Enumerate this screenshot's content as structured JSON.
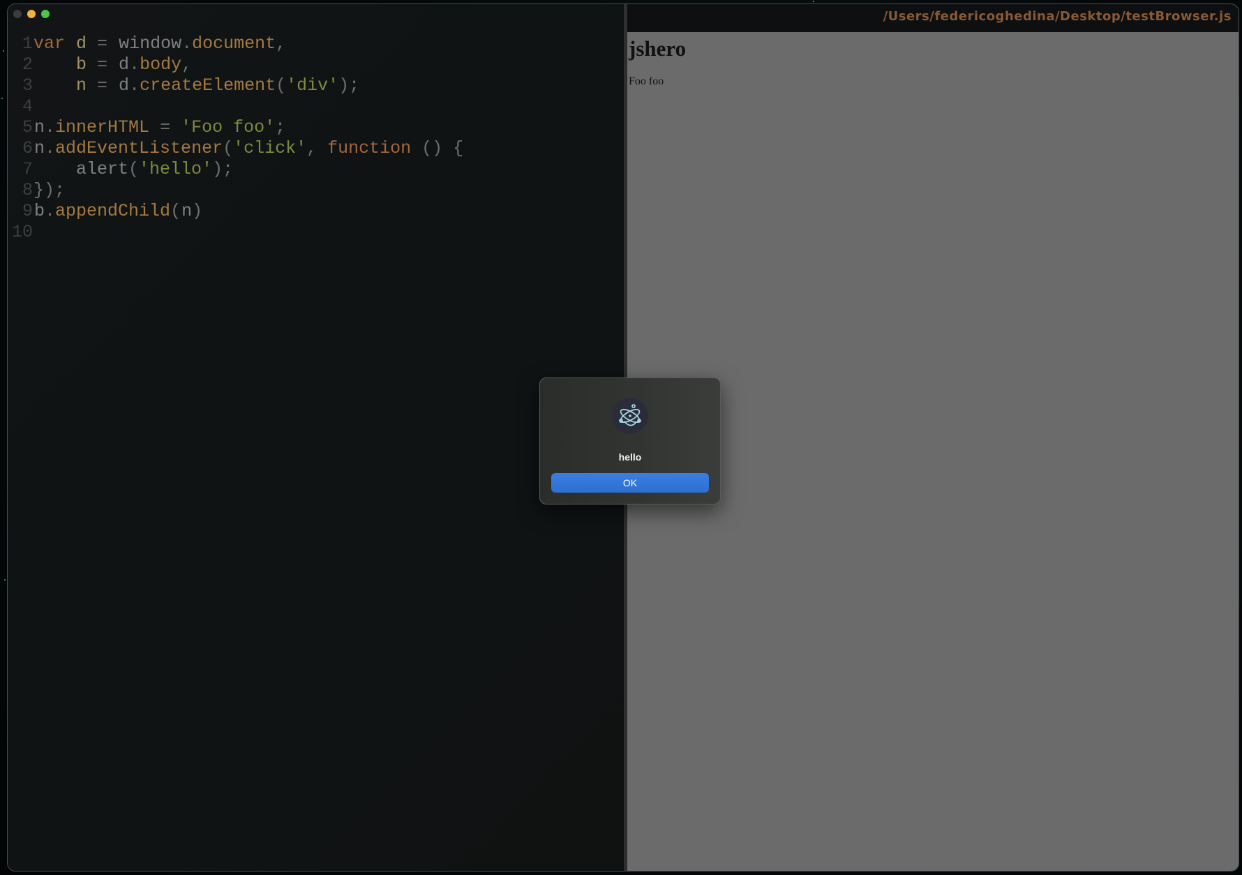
{
  "editor": {
    "lines": [
      {
        "n": "1",
        "tokens": [
          [
            "kw",
            "var"
          ],
          [
            "src",
            " "
          ],
          [
            "var",
            "d"
          ],
          [
            "pun",
            " = "
          ],
          [
            "src",
            "window"
          ],
          [
            "pun",
            "."
          ],
          [
            "prop",
            "document"
          ],
          [
            "pun",
            ","
          ]
        ]
      },
      {
        "n": "2",
        "tokens": [
          [
            "src",
            "    "
          ],
          [
            "var",
            "b"
          ],
          [
            "pun",
            " = "
          ],
          [
            "src",
            "d"
          ],
          [
            "pun",
            "."
          ],
          [
            "prop",
            "body"
          ],
          [
            "pun",
            ","
          ]
        ]
      },
      {
        "n": "3",
        "tokens": [
          [
            "src",
            "    "
          ],
          [
            "var",
            "n"
          ],
          [
            "pun",
            " = "
          ],
          [
            "src",
            "d"
          ],
          [
            "pun",
            "."
          ],
          [
            "prop",
            "createElement"
          ],
          [
            "pun",
            "("
          ],
          [
            "str",
            "'div'"
          ],
          [
            "pun",
            ");"
          ]
        ]
      },
      {
        "n": "4",
        "tokens": []
      },
      {
        "n": "5",
        "tokens": [
          [
            "src",
            "n"
          ],
          [
            "pun",
            "."
          ],
          [
            "prop",
            "innerHTML"
          ],
          [
            "pun",
            " = "
          ],
          [
            "str",
            "'Foo foo'"
          ],
          [
            "pun",
            ";"
          ]
        ]
      },
      {
        "n": "6",
        "tokens": [
          [
            "src",
            "n"
          ],
          [
            "pun",
            "."
          ],
          [
            "prop",
            "addEventListener"
          ],
          [
            "pun",
            "("
          ],
          [
            "str",
            "'click'"
          ],
          [
            "pun",
            ", "
          ],
          [
            "kw",
            "function"
          ],
          [
            "pun",
            " () {"
          ]
        ]
      },
      {
        "n": "7",
        "tokens": [
          [
            "src",
            "    alert"
          ],
          [
            "pun",
            "("
          ],
          [
            "str",
            "'hello'"
          ],
          [
            "pun",
            ");"
          ]
        ]
      },
      {
        "n": "8",
        "tokens": [
          [
            "pun",
            "});"
          ]
        ]
      },
      {
        "n": "9",
        "tokens": [
          [
            "src",
            "b"
          ],
          [
            "pun",
            "."
          ],
          [
            "prop",
            "appendChild"
          ],
          [
            "pun",
            "("
          ],
          [
            "src",
            "n"
          ],
          [
            "pun",
            ")"
          ]
        ]
      },
      {
        "n": "10",
        "tokens": []
      }
    ]
  },
  "preview": {
    "file_path": "/Users/federicoghedina/Desktop/testBrowser.js",
    "heading": "jshero",
    "div_text": "Foo foo"
  },
  "dialog": {
    "icon": "electron-atom-icon",
    "message": "hello",
    "ok_label": "OK",
    "button_color": "#2f74d6"
  },
  "colors": {
    "keyword": "#a3673a",
    "property": "#a37a43",
    "string": "#7f8a3e",
    "variable": "#9e9466",
    "path_text": "#8a5a36"
  }
}
